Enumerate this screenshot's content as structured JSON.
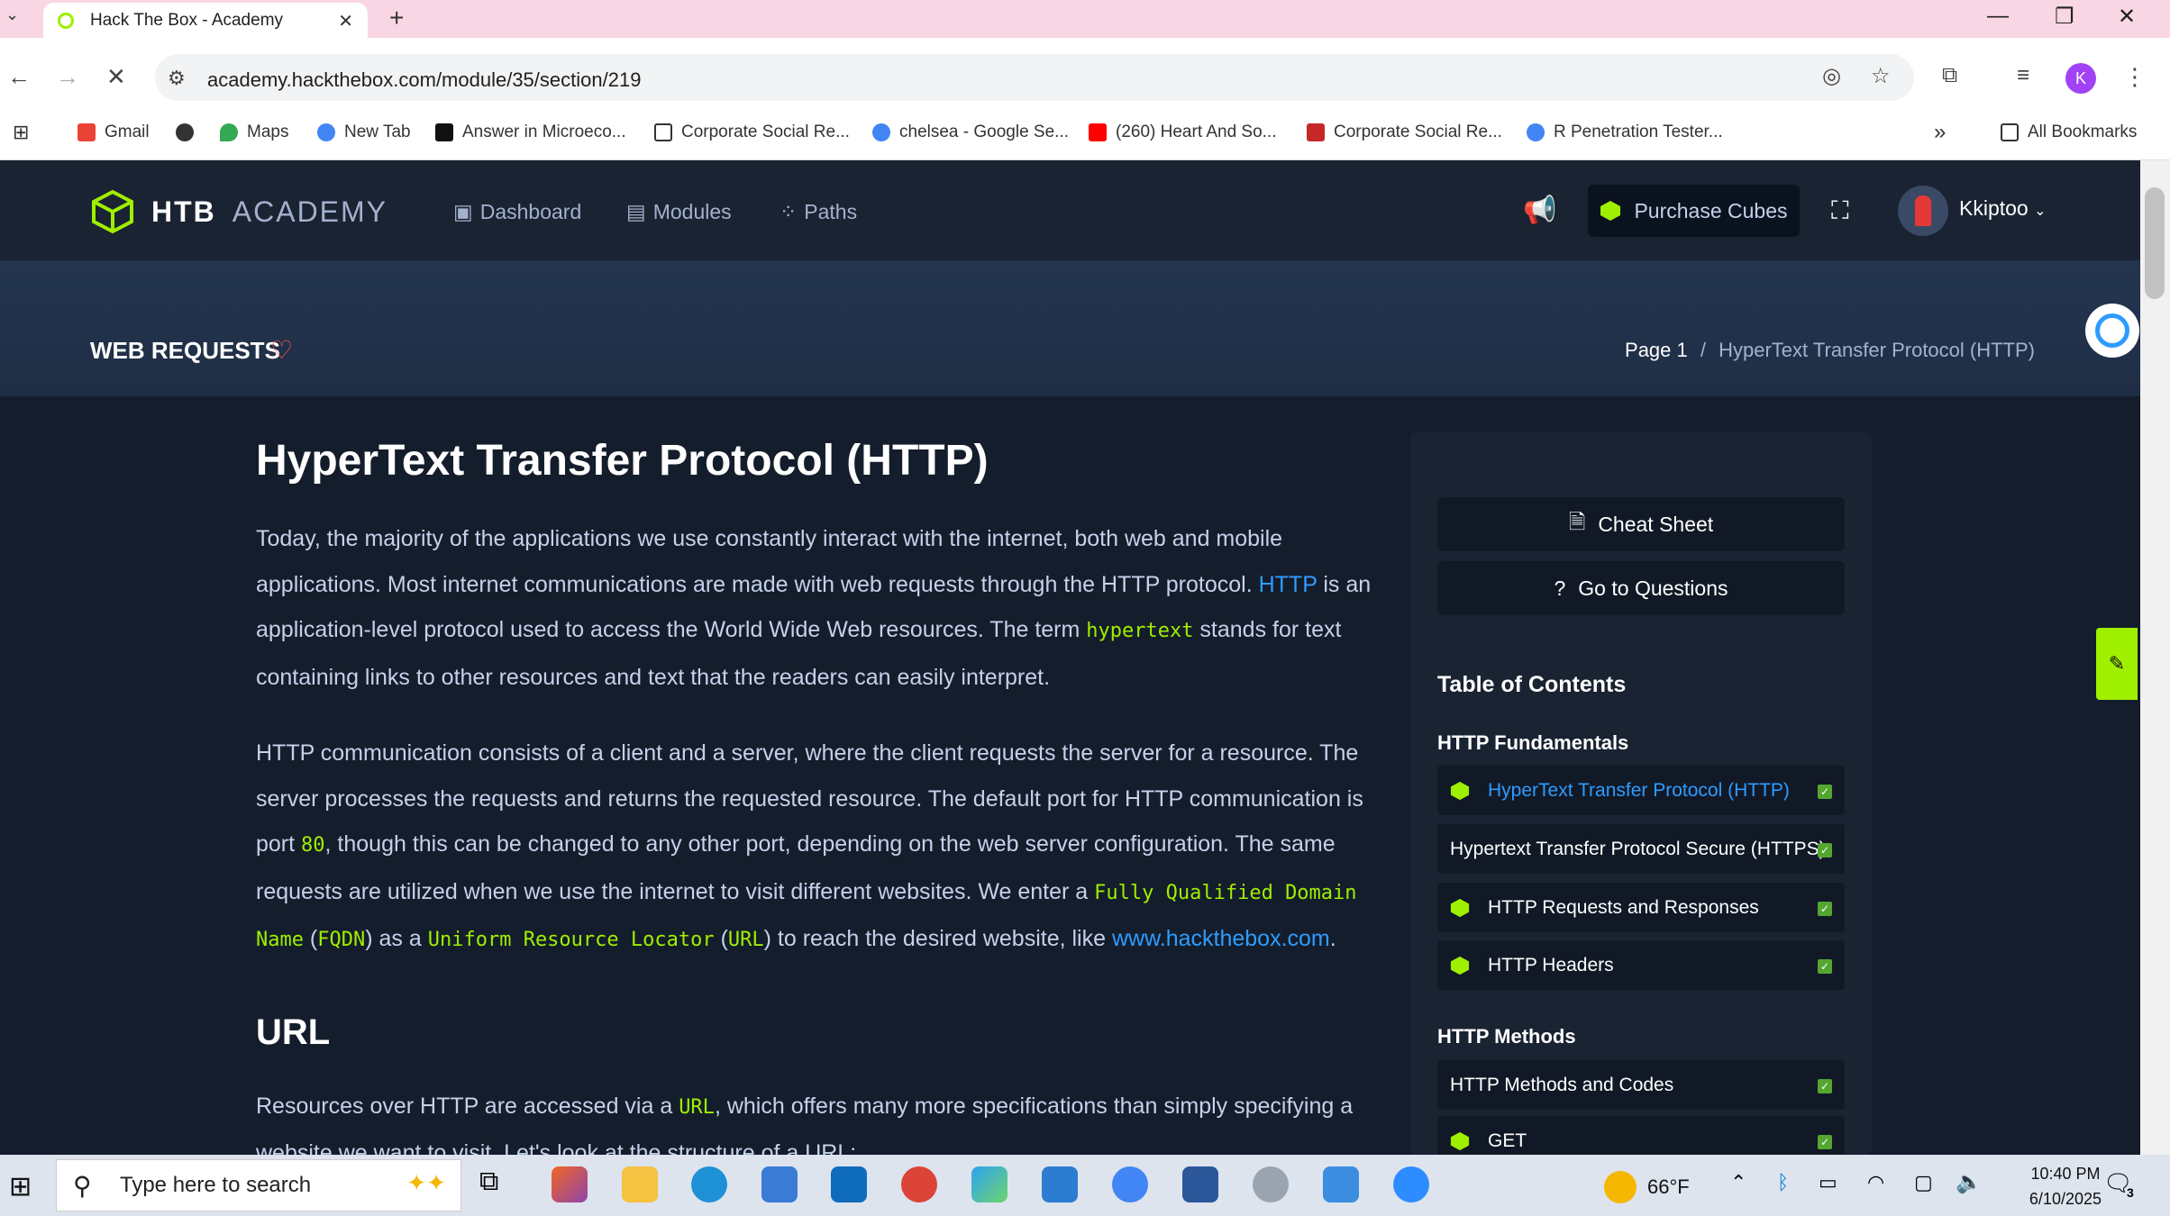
{
  "browser": {
    "tab_title": "Hack The Box - Academy",
    "url": "academy.hackthebox.com/module/35/section/219",
    "profile_initial": "K",
    "bookmarks": [
      {
        "label": "Gmail"
      },
      {
        "label": ""
      },
      {
        "label": "Maps"
      },
      {
        "label": "New Tab"
      },
      {
        "label": "Answer in Microeco..."
      },
      {
        "label": "Corporate Social Re..."
      },
      {
        "label": "chelsea - Google Se..."
      },
      {
        "label": "(260) Heart And So..."
      },
      {
        "label": "Corporate Social Re..."
      },
      {
        "label": "R Penetration Tester..."
      }
    ],
    "more_bookmarks": "»",
    "all_bookmarks": "All Bookmarks"
  },
  "htb": {
    "logo_bold": "HTB",
    "logo_light": "ACADEMY",
    "nav": [
      {
        "label": "Dashboard"
      },
      {
        "label": "Modules"
      },
      {
        "label": "Paths"
      }
    ],
    "purchase_label": "Purchase Cubes",
    "username": "Kkiptoo"
  },
  "module": {
    "title": "WEB REQUESTS",
    "breadcrumb_page": "Page 1",
    "breadcrumb_sep": "/",
    "breadcrumb_section": "HyperText Transfer Protocol (HTTP)"
  },
  "article": {
    "heading": "HyperText Transfer Protocol (HTTP)",
    "p1_a": "Today, the majority of the applications we use constantly interact with the internet, both web and mobile applications. Most internet communications are made with web requests through the HTTP protocol. ",
    "p1_link": "HTTP",
    "p1_b": " is an application-level protocol used to access the World Wide Web resources. The term ",
    "p1_code": "hypertext",
    "p1_c": " stands for text containing links to other resources and text that the readers can easily interpret.",
    "p2_a": "HTTP communication consists of a client and a server, where the client requests the server for a resource. The server processes the requests and returns the requested resource. The default port for HTTP communication is port ",
    "p2_port": "80",
    "p2_b": ", though this can be changed to any other port, depending on the web server configuration. The same requests are utilized when we use the internet to visit different websites. We enter a ",
    "p2_fqdn": "Fully Qualified Domain Name",
    "p2_c": " (",
    "p2_fqdn_abbr": "FQDN",
    "p2_d": ") as a ",
    "p2_url": "Uniform Resource Locator",
    "p2_e": " (",
    "p2_url_abbr": "URL",
    "p2_f": ") to reach the desired website, like ",
    "p2_link": "www.hackthebox.com",
    "p2_g": ".",
    "h2": "URL",
    "p3_a": "Resources over HTTP are accessed via a ",
    "p3_code": "URL",
    "p3_b": ", which offers many more specifications than simply specifying a website we want to visit. Let's look at the structure of a URL:"
  },
  "side": {
    "cheat_sheet": "Cheat Sheet",
    "go_questions": "Go to Questions",
    "toc_title": "Table of Contents",
    "group1": "HTTP Fundamentals",
    "group1_items": [
      "HyperText Transfer Protocol (HTTP)",
      "Hypertext Transfer Protocol Secure (HTTPS)",
      "HTTP Requests and Responses",
      "HTTP Headers"
    ],
    "group2": "HTTP Methods",
    "group2_items": [
      "HTTP Methods and Codes",
      "GET"
    ]
  },
  "taskbar": {
    "search_placeholder": "Type here to search",
    "weather": "66°F",
    "time": "10:40 PM",
    "date": "6/10/2025",
    "notif_count": "3"
  },
  "colors": {
    "accent": "#9fef00",
    "link": "#2e9cff",
    "bg": "#141d2b"
  }
}
